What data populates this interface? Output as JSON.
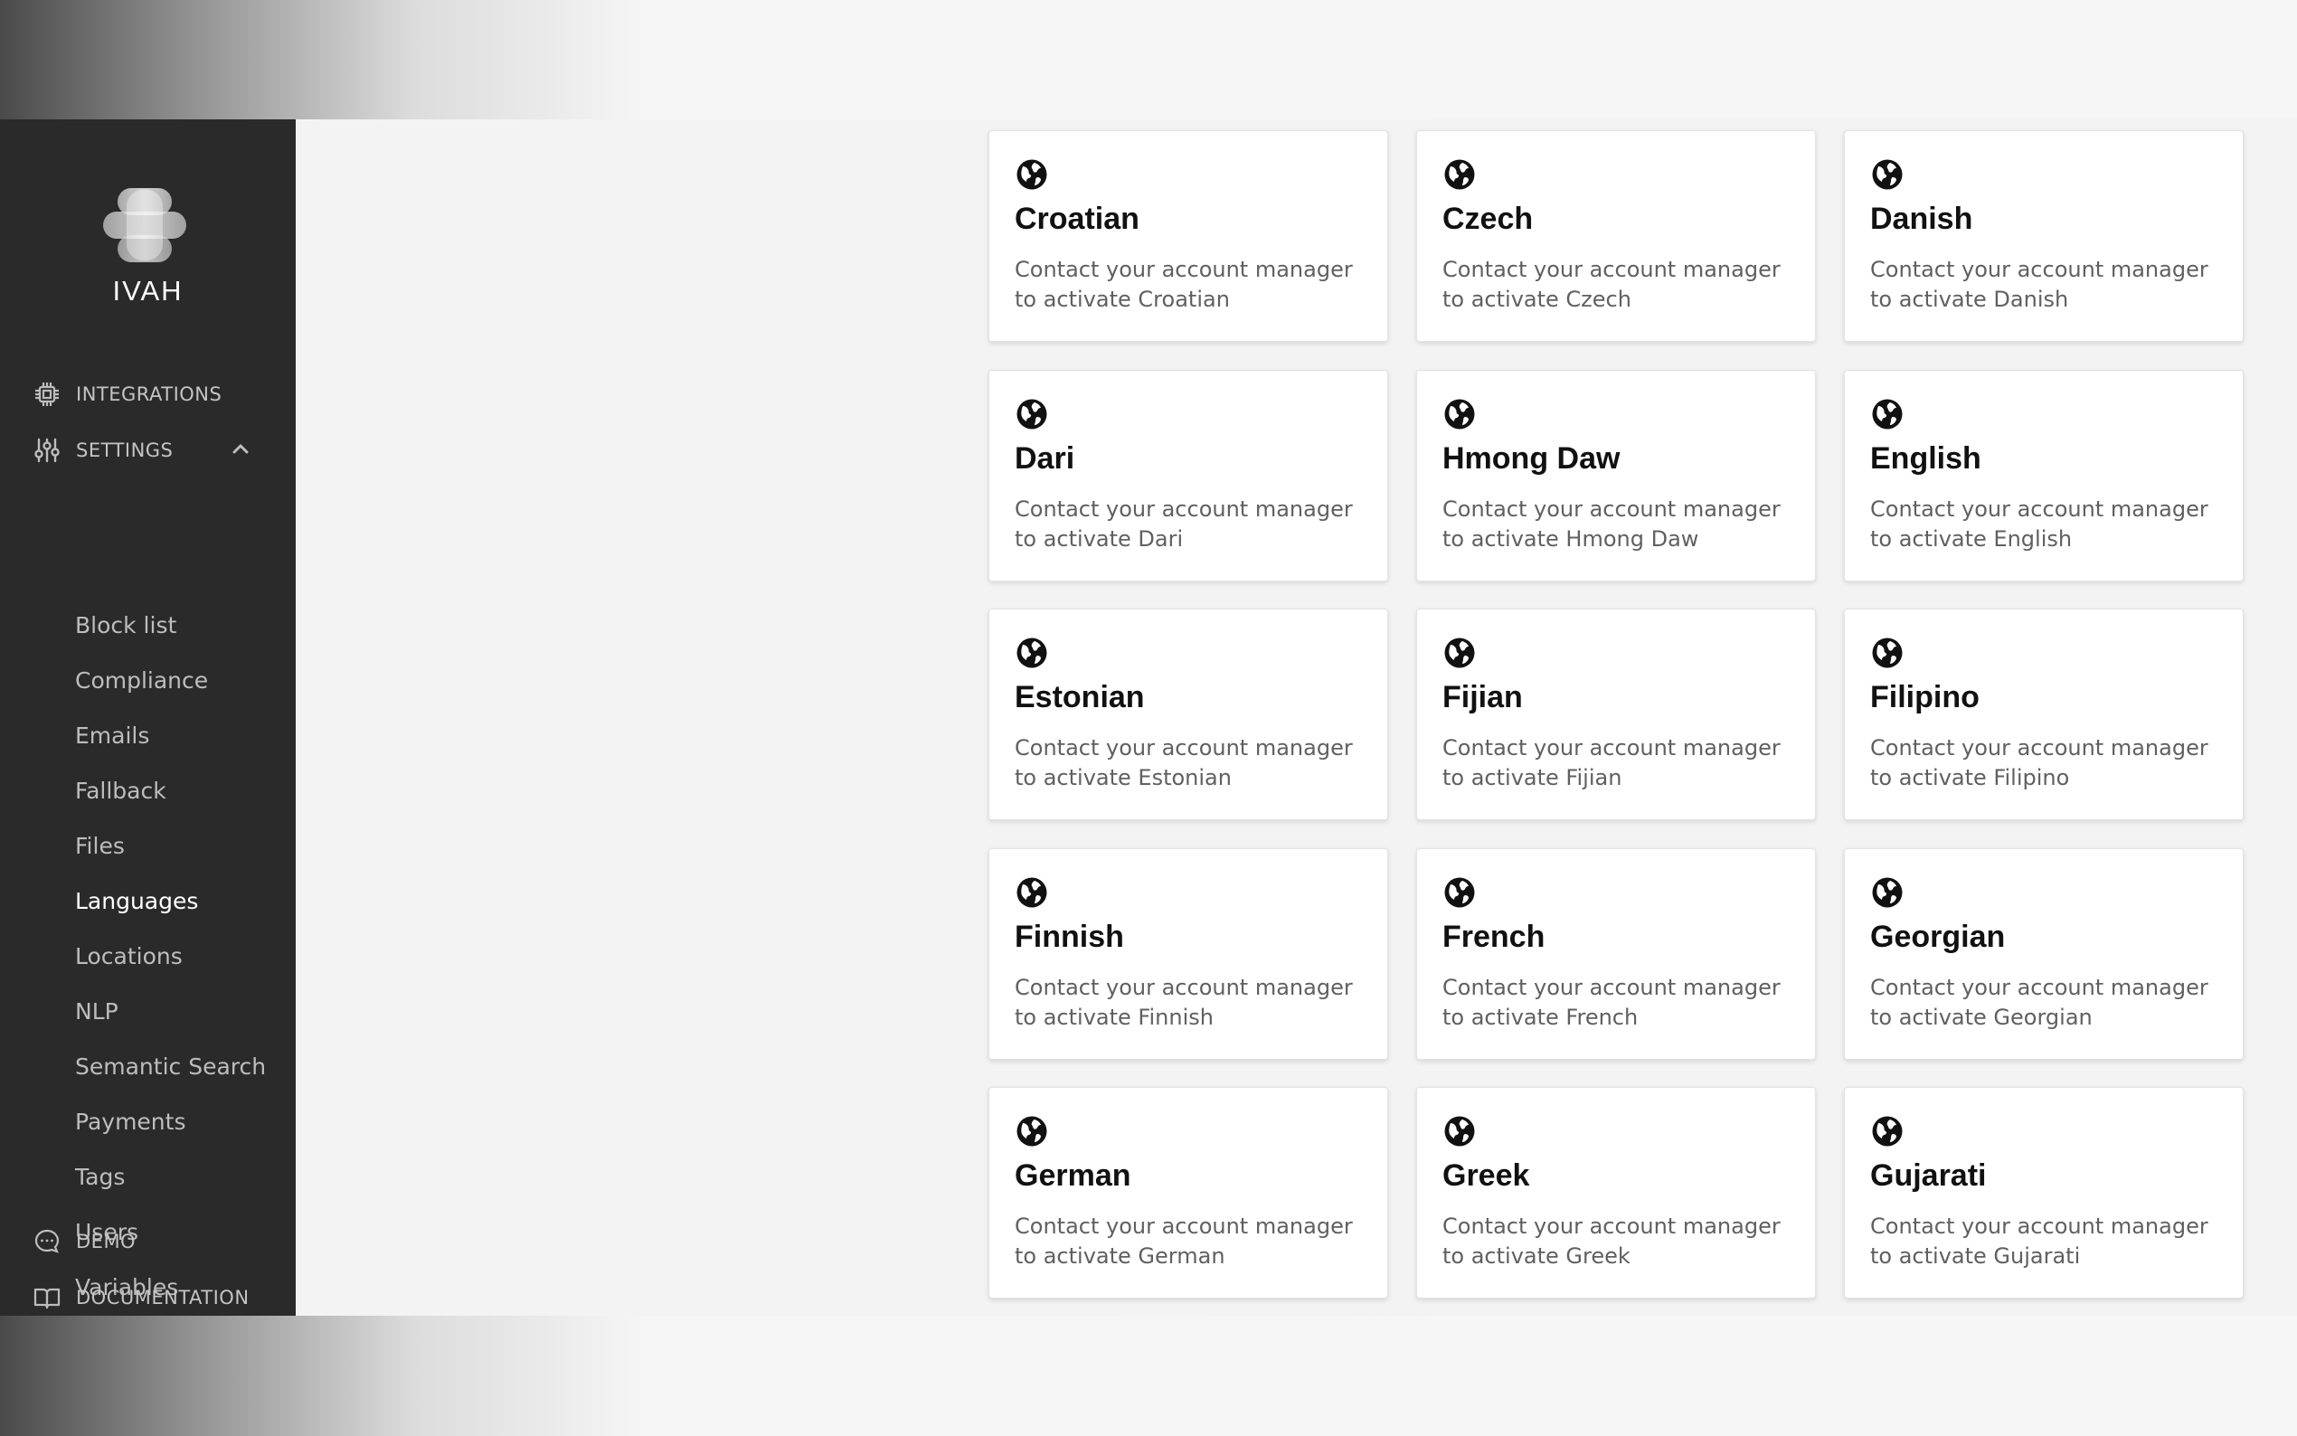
{
  "app": {
    "brand": "IVAH"
  },
  "sidebar": {
    "integrations_label": "INTEGRATIONS",
    "settings_label": "SETTINGS",
    "sub_items": [
      {
        "label": "Block list"
      },
      {
        "label": "Compliance"
      },
      {
        "label": "Emails"
      },
      {
        "label": "Fallback"
      },
      {
        "label": "Files"
      },
      {
        "label": "Languages",
        "active": true
      },
      {
        "label": "Locations"
      },
      {
        "label": "NLP"
      },
      {
        "label": "Semantic Search"
      },
      {
        "label": "Payments"
      },
      {
        "label": "Tags"
      },
      {
        "label": "Users"
      },
      {
        "label": "Variables"
      }
    ],
    "demo_label": "DEMO",
    "documentation_label": "DOCUMENTATION"
  },
  "languages": [
    {
      "name": "Croatian",
      "desc": "Contact your account manager to activate Croatian"
    },
    {
      "name": "Czech",
      "desc": "Contact your account manager to activate Czech"
    },
    {
      "name": "Danish",
      "desc": "Contact your account manager to activate Danish"
    },
    {
      "name": "Dari",
      "desc": "Contact your account manager to activate Dari"
    },
    {
      "name": "Hmong Daw",
      "desc": "Contact your account manager to activate Hmong Daw"
    },
    {
      "name": "English",
      "desc": "Contact your account manager to activate English"
    },
    {
      "name": "Estonian",
      "desc": "Contact your account manager to activate Estonian"
    },
    {
      "name": "Fijian",
      "desc": "Contact your account manager to activate Fijian"
    },
    {
      "name": "Filipino",
      "desc": "Contact your account manager to activate Filipino"
    },
    {
      "name": "Finnish",
      "desc": "Contact your account manager to activate Finnish"
    },
    {
      "name": "French",
      "desc": "Contact your account manager to activate French"
    },
    {
      "name": "Georgian",
      "desc": "Contact your account manager to activate Georgian"
    },
    {
      "name": "German",
      "desc": "Contact your account manager to activate German"
    },
    {
      "name": "Greek",
      "desc": "Contact your account manager to activate Greek"
    },
    {
      "name": "Gujarati",
      "desc": "Contact your account manager to activate Gujarati"
    }
  ],
  "colors": {
    "sidebar_bg": "#2a2a2a",
    "active_text": "#ffffff",
    "muted_text": "#bdbdbd"
  },
  "icons": {
    "card": "globe-icon",
    "integrations": "chip-icon",
    "settings": "sliders-icon",
    "demo": "chat-icon",
    "documentation": "book-icon"
  }
}
